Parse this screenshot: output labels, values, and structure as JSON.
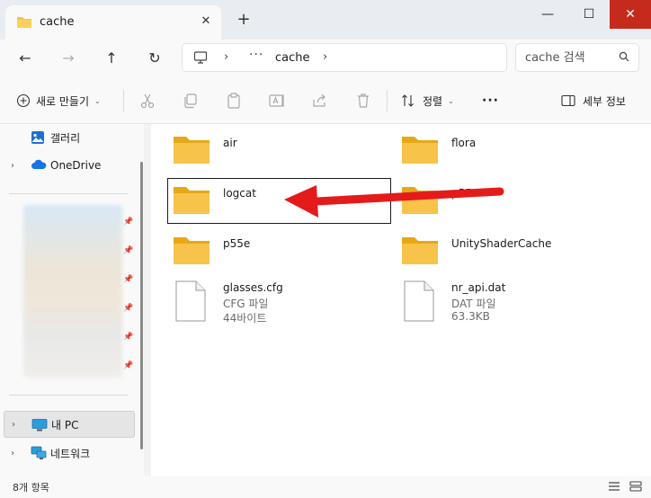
{
  "window": {
    "tab_title": "cache",
    "tab_close": "✕",
    "new_tab": "+",
    "min": "—",
    "max": "☐",
    "close": "✕"
  },
  "nav": {
    "back": "←",
    "forward": "→",
    "up": "↑",
    "refresh": "↻",
    "address_more": "···",
    "address_current": "cache",
    "search_placeholder": "cache 검색"
  },
  "toolbar": {
    "new_label": "새로 만들기",
    "sort_label": "정렬",
    "more_label": "···",
    "details_label": "세부 정보"
  },
  "sidebar": {
    "items": [
      {
        "label": "갤러리"
      },
      {
        "label": "OneDrive"
      },
      {
        "label": "내 PC"
      },
      {
        "label": "네트워크"
      }
    ]
  },
  "files": [
    {
      "name": "air",
      "type": "folder"
    },
    {
      "name": "flora",
      "type": "folder"
    },
    {
      "name": "logcat",
      "type": "folder"
    },
    {
      "name": "p55",
      "type": "folder"
    },
    {
      "name": "p55e",
      "type": "folder"
    },
    {
      "name": "UnityShaderCache",
      "type": "folder"
    },
    {
      "name": "glasses.cfg",
      "type": "file",
      "kind": "CFG 파일",
      "size": "44바이트"
    },
    {
      "name": "nr_api.dat",
      "type": "file",
      "kind": "DAT 파일",
      "size": "63.3KB"
    }
  ],
  "status": {
    "count": "8개 항목"
  },
  "colors": {
    "folder": "#f8c34a",
    "folder_dark": "#e6a817",
    "close_red": "#c42b1c",
    "annotation_red": "#e31b1b"
  }
}
